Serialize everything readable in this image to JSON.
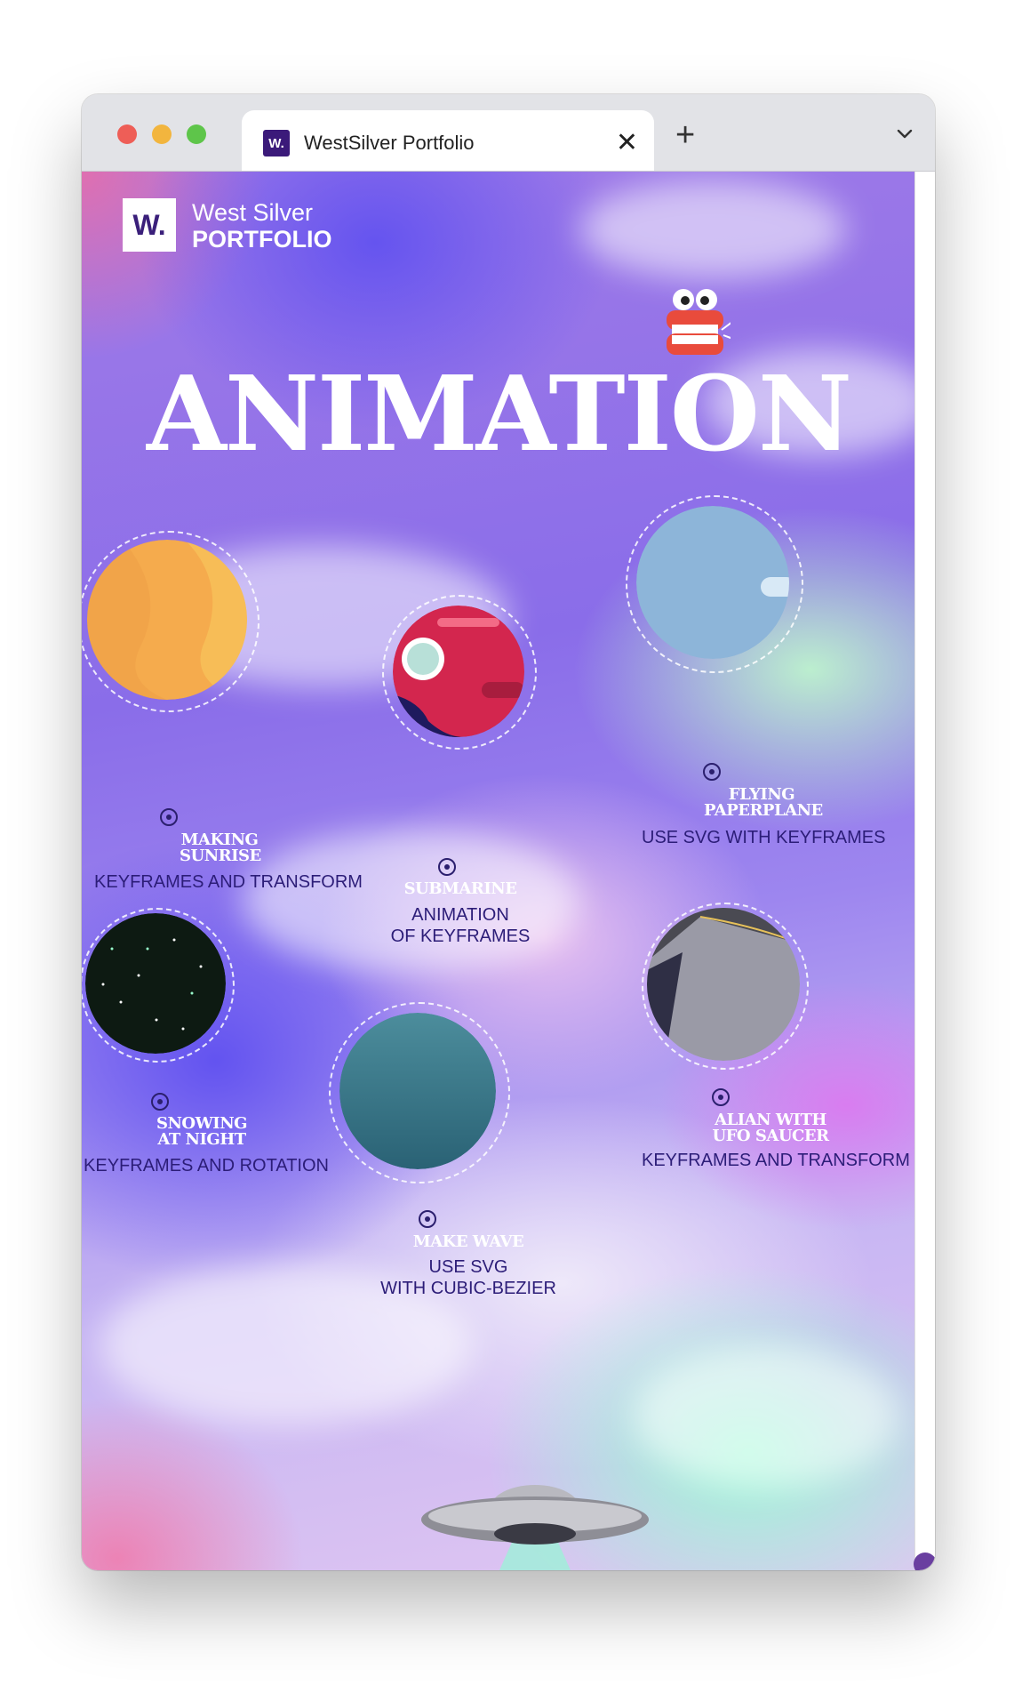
{
  "browser": {
    "tab_title": "WestSilver Portfolio",
    "favicon_text": "W.",
    "close_glyph": "✕",
    "new_tab_glyph": "+",
    "tab_menu_icon": "chevron-down-icon"
  },
  "site": {
    "logo_mark": "W.",
    "logo_top": "West Silver",
    "logo_bottom": "PORTFOLIO",
    "hero_title": "ANIMATION"
  },
  "demos": [
    {
      "name_line1": "MAKING",
      "name_line2": "SUNRISE",
      "desc_line1": "KEYFRAMES AND TRANSFORM",
      "desc_line2": ""
    },
    {
      "name_line1": "SUBMARINE",
      "name_line2": "",
      "desc_line1": "ANIMATION",
      "desc_line2": "OF KEYFRAMES"
    },
    {
      "name_line1": "FLYING",
      "name_line2": "PAPERPLANE",
      "desc_line1": "USE SVG WITH KEYFRAMES",
      "desc_line2": ""
    },
    {
      "name_line1": "SNOWING",
      "name_line2": "AT NIGHT",
      "desc_line1": "KEYFRAMES AND ROTATION",
      "desc_line2": ""
    },
    {
      "name_line1": "MAKE WAVE",
      "name_line2": "",
      "desc_line1": "USE SVG",
      "desc_line2": "WITH CUBIC-BEZIER"
    },
    {
      "name_line1": "ALIAN WITH",
      "name_line2": "UFO SAUCER",
      "desc_line1": "KEYFRAMES AND TRANSFORM",
      "desc_line2": ""
    }
  ],
  "colors": {
    "accent": "#2c1d78",
    "brand": "#3a1f7a",
    "scroll_thumb": "#6a3fa0"
  }
}
